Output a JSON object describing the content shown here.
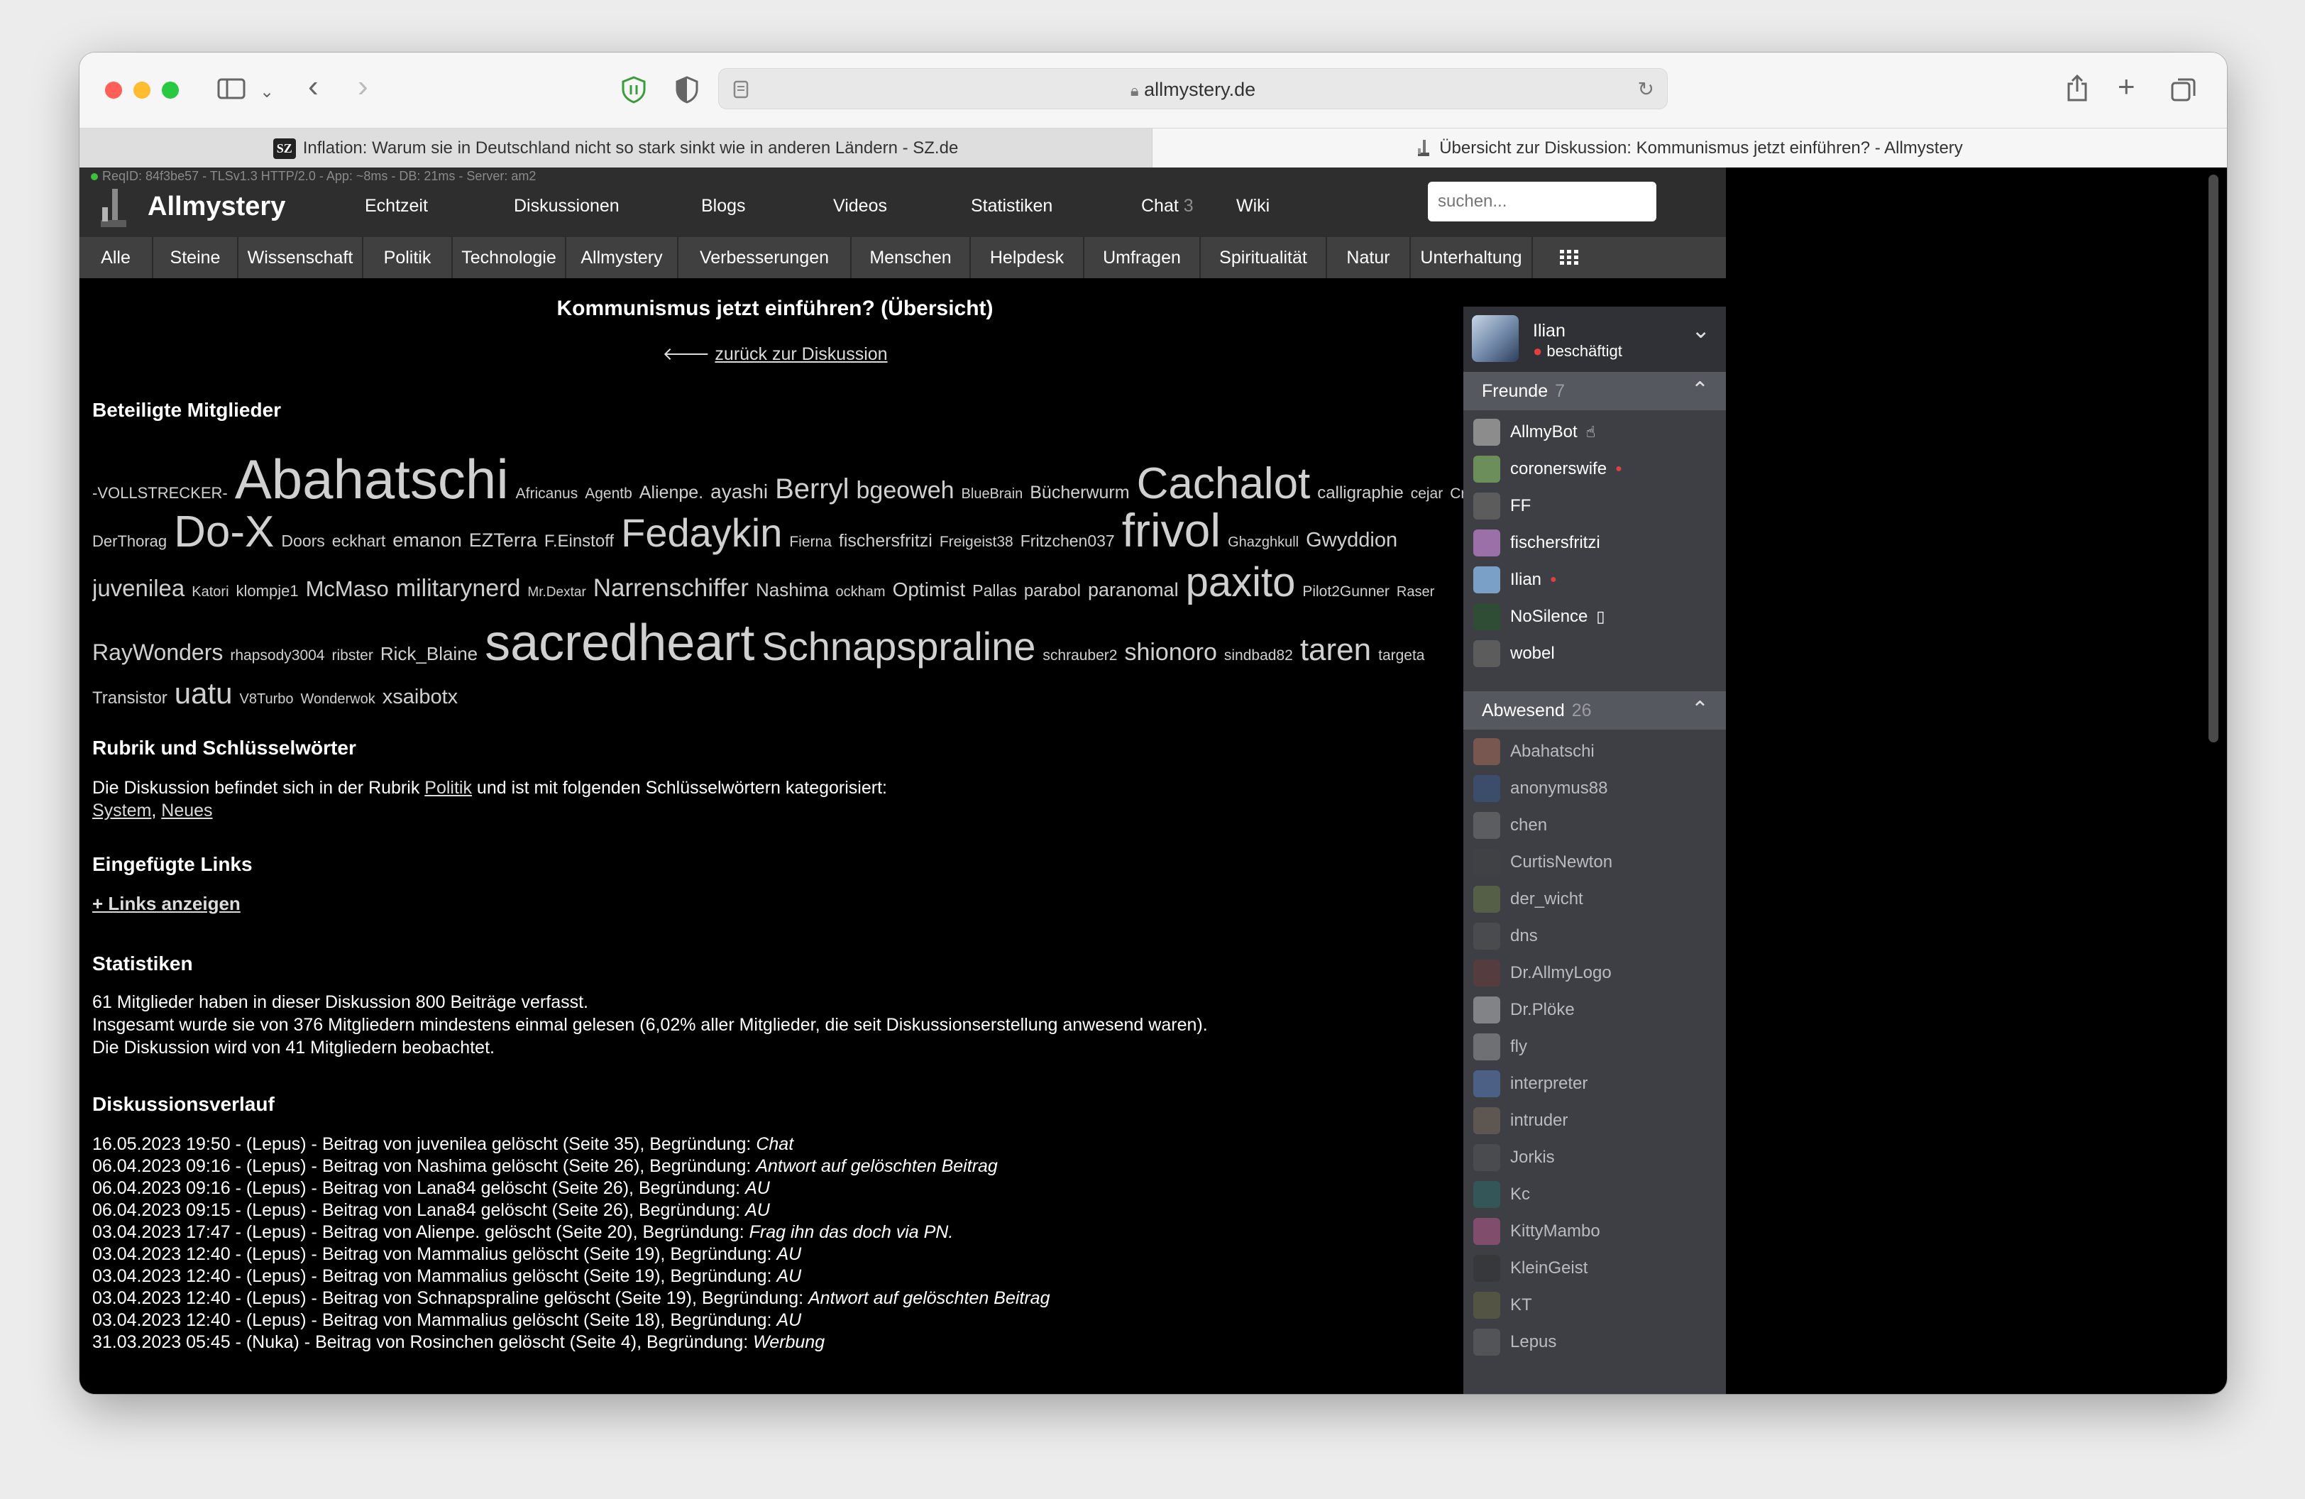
{
  "browser": {
    "url": "allmystery.de",
    "tabs": [
      {
        "label": "Inflation: Warum sie in Deutschland nicht so stark sinkt wie in anderen Ländern - SZ.de",
        "favicon": "SZ"
      },
      {
        "label": "Übersicht zur Diskussion: Kommunismus jetzt einführen? - Allmystery"
      }
    ]
  },
  "site": {
    "debug": "ReqID: 84f3be57 - TLSv1.3 HTTP/2.0 - App: ~8ms - DB: 21ms - Server: am2",
    "logo": "Allmystery",
    "nav": [
      "Echtzeit",
      "Diskussionen",
      "Blogs",
      "Videos",
      "Statistiken",
      "Chat",
      "Wiki"
    ],
    "chat_count": "3",
    "search_placeholder": "suchen...",
    "categories": [
      "Alle",
      "Steine",
      "Wissenschaft",
      "Politik",
      "Technologie",
      "Allmystery",
      "Verbesserungen",
      "Menschen",
      "Helpdesk",
      "Umfragen",
      "Spiritualität",
      "Natur",
      "Unterhaltung"
    ]
  },
  "page": {
    "title": "Kommunismus jetzt einführen? (Übersicht)",
    "back_link": "zurück zur Diskussion",
    "members_heading": "Beteiligte Mitglieder",
    "rubrik_heading": "Rubrik und Schlüsselwörter",
    "rubrik_text_pre": "Die Diskussion befindet sich in der Rubrik",
    "rubrik_link": "Politik",
    "rubrik_text_post": "und ist mit folgenden Schlüsselwörtern kategorisiert:",
    "keyword1": "System",
    "keyword_sep": ",",
    "keyword2": "Neues",
    "links_heading": "Eingefügte Links",
    "links_toggle": "+ Links anzeigen",
    "stats_heading": "Statistiken",
    "stats": [
      "61 Mitglieder haben in dieser Diskussion 800 Beiträge verfasst.",
      "Insgesamt wurde sie von 376 Mitgliedern mindestens einmal gelesen (6,02% aller Mitglieder, die seit Diskussionserstellung anwesend waren).",
      "Die Diskussion wird von 41 Mitgliedern beobachtet."
    ],
    "history_heading": "Diskussionsverlauf",
    "history": [
      {
        "text": "16.05.2023 19:50 - (Lepus) - Beitrag von juvenilea gelöscht (Seite 35), Begründung:",
        "reason": "Chat"
      },
      {
        "text": "06.04.2023 09:16 - (Lepus) - Beitrag von Nashima gelöscht (Seite 26), Begründung:",
        "reason": "Antwort auf gelöschten Beitrag"
      },
      {
        "text": "06.04.2023 09:16 - (Lepus) - Beitrag von Lana84 gelöscht (Seite 26), Begründung:",
        "reason": "AU"
      },
      {
        "text": "06.04.2023 09:15 - (Lepus) - Beitrag von Lana84 gelöscht (Seite 26), Begründung:",
        "reason": "AU"
      },
      {
        "text": "03.04.2023 17:47 - (Lepus) - Beitrag von Alienpe. gelöscht (Seite 20), Begründung:",
        "reason": "Frag ihn das doch via PN."
      },
      {
        "text": "03.04.2023 12:40 - (Lepus) - Beitrag von Mammalius gelöscht (Seite 19), Begründung:",
        "reason": "AU"
      },
      {
        "text": "03.04.2023 12:40 - (Lepus) - Beitrag von Mammalius gelöscht (Seite 19), Begründung:",
        "reason": "AU"
      },
      {
        "text": "03.04.2023 12:40 - (Lepus) - Beitrag von Schnapspraline gelöscht (Seite 19), Begründung:",
        "reason": "Antwort auf gelöschten Beitrag"
      },
      {
        "text": "03.04.2023 12:40 - (Lepus) - Beitrag von Mammalius gelöscht (Seite 18), Begründung:",
        "reason": "AU"
      },
      {
        "text": "31.03.2023 05:45 - (Nuka) - Beitrag von Rosinchen gelöscht (Seite 4), Begründung:",
        "reason": "Werbung"
      }
    ]
  },
  "cloud_lines": [
    [
      "-VOLLSTRECKER-",
      "Abahatschi",
      "Africanus",
      "Agentb",
      "Alienpe.",
      "ayashi",
      "Berryl",
      "bgeoweh",
      "BlueBrain",
      "Bücherwurm",
      "Cachalot",
      "calligraphie",
      "cejar",
      "Crrs"
    ],
    [
      "DerThorag",
      "Do-X",
      "Doors",
      "eckhart",
      "emanon",
      "EZTerra",
      "F.Einstoff",
      "Fedaykin",
      "Fierna",
      "fischersfritzi",
      "Freigeist38",
      "Fritzchen037",
      "frivol",
      "Ghazghkull",
      "Gwyddion"
    ],
    [
      "juvenilea",
      "Katori",
      "klompje1",
      "McMaso",
      "militarynerd",
      "Mr.Dextar",
      "Narrenschiffer",
      "Nashima",
      "ockham",
      "Optimist",
      "Pallas",
      "parabol",
      "paranomal",
      "paxito",
      "Pilot2Gunner",
      "Raser"
    ],
    [
      "RayWonders",
      "rhapsody3004",
      "ribster",
      "Rick_Blaine",
      "sacredheart",
      "Schnapspraline",
      "schrauber2",
      "shionoro",
      "sindbad82",
      "taren",
      "targeta"
    ],
    [
      "Transistor",
      "uatu",
      "V8Turbo",
      "Wonderwok",
      "xsaibotx"
    ]
  ],
  "chat": {
    "user": "Ilian",
    "status": "beschäftigt",
    "friends_label": "Freunde",
    "friends_count": "7",
    "friends": [
      "AllmyBot",
      "coronerswife",
      "FF",
      "fischersfritzi",
      "Ilian",
      "NoSilence",
      "wobel"
    ],
    "away_label": "Abwesend",
    "away_count": "26",
    "away": [
      "Abahatschi",
      "anonymus88",
      "chen",
      "CurtisNewton",
      "der_wicht",
      "dns",
      "Dr.AllmyLogo",
      "Dr.Plöke",
      "fly",
      "interpreter",
      "intruder",
      "Jorkis",
      "Kc",
      "KittyMambo",
      "KleinGeist",
      "KT",
      "Lepus"
    ]
  }
}
